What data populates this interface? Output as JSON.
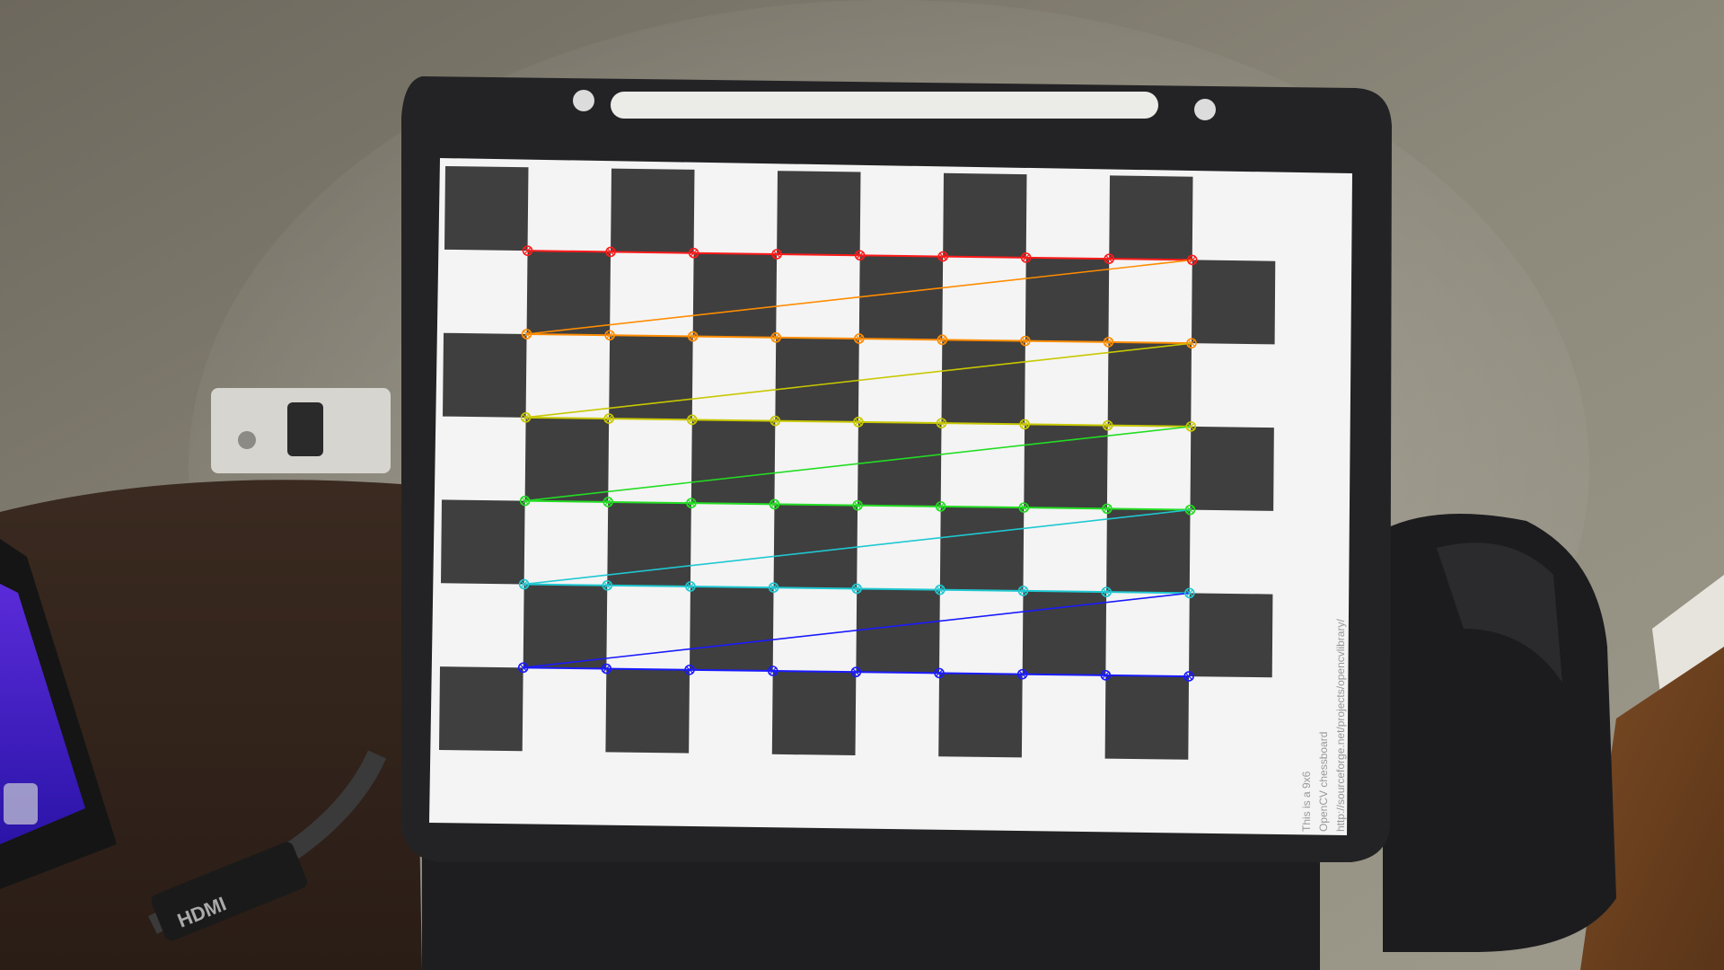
{
  "screen": {
    "caption_lines": [
      "This is a 9x6",
      "OpenCV chessboard",
      "http://sourceforge.net/projects/opencvlibrary/"
    ]
  },
  "devices": {
    "laptop_port_label": "HDMI"
  },
  "chessboard": {
    "squares_cols": 10,
    "squares_rows": 7,
    "inner_corners_cols": 9,
    "inner_corners_rows": 6,
    "square_color": "#3f3f3f",
    "background_color": "#f4f4f4",
    "row_colors": [
      "#ff1a1a",
      "#ff8c00",
      "#c8c800",
      "#22dd22",
      "#1ec8d2",
      "#1a1aff"
    ]
  }
}
